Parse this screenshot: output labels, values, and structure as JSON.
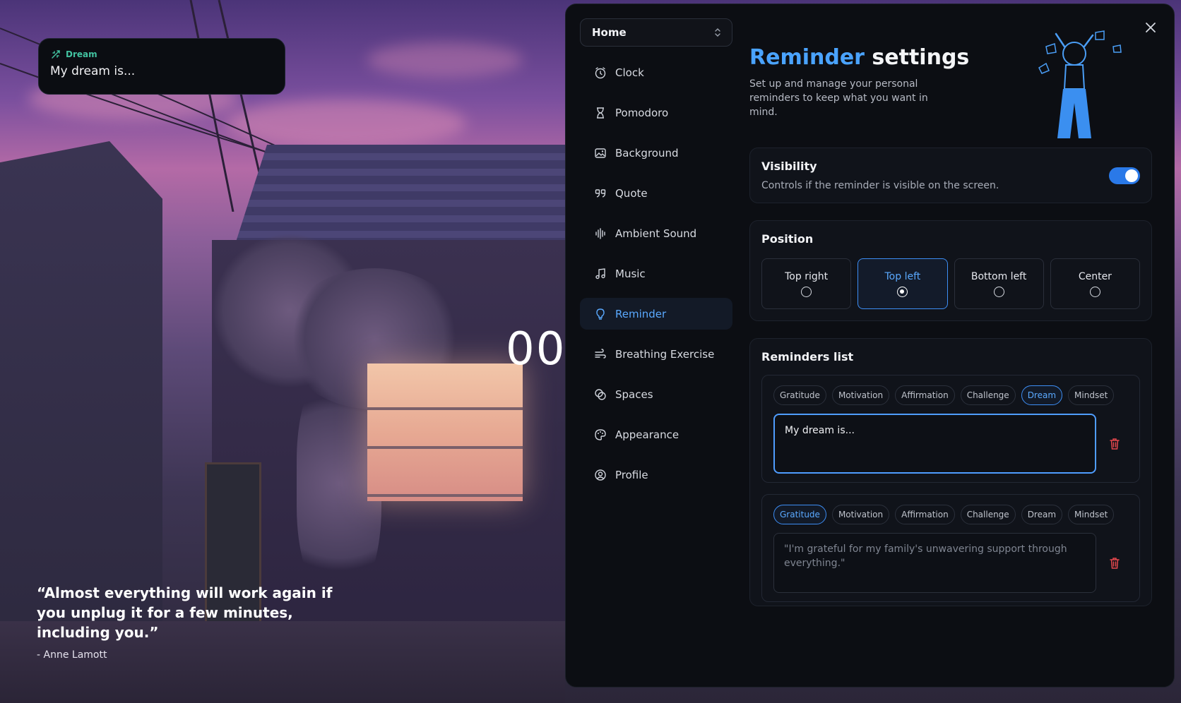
{
  "widget": {
    "tag": "Dream",
    "text": "My dream is..."
  },
  "clock": {
    "digits": "00"
  },
  "quote": {
    "text": "“Almost everything will work again if you unplug it for a few minutes, including you.”",
    "author": "- Anne Lamott"
  },
  "nav": {
    "select_value": "Home",
    "items": [
      {
        "label": "Clock",
        "icon": "clock-icon"
      },
      {
        "label": "Pomodoro",
        "icon": "hourglass-icon"
      },
      {
        "label": "Background",
        "icon": "image-icon"
      },
      {
        "label": "Quote",
        "icon": "quote-icon"
      },
      {
        "label": "Ambient Sound",
        "icon": "sound-wave-icon"
      },
      {
        "label": "Music",
        "icon": "music-icon"
      },
      {
        "label": "Reminder",
        "icon": "lightbulb-icon",
        "active": true
      },
      {
        "label": "Breathing Exercise",
        "icon": "wind-icon"
      },
      {
        "label": "Spaces",
        "icon": "spaces-icon"
      },
      {
        "label": "Appearance",
        "icon": "palette-icon"
      },
      {
        "label": "Profile",
        "icon": "user-circle-icon"
      }
    ]
  },
  "header": {
    "title_accent": "Reminder",
    "title_rest": " settings",
    "subtitle": "Set up and manage your personal reminders to keep what you want in mind."
  },
  "visibility": {
    "title": "Visibility",
    "description": "Controls if the reminder is visible on the screen.",
    "enabled": true
  },
  "position": {
    "title": "Position",
    "options": [
      "Top right",
      "Top left",
      "Bottom left",
      "Center"
    ],
    "selected": "Top left"
  },
  "reminders": {
    "title": "Reminders list",
    "categories": [
      "Gratitude",
      "Motivation",
      "Affirmation",
      "Challenge",
      "Dream",
      "Mindset"
    ],
    "items": [
      {
        "category": "Dream",
        "text": "My dream is..."
      },
      {
        "category": "Gratitude",
        "placeholder": "\"I'm grateful for my family's unwavering support through everything.\""
      }
    ]
  },
  "colors": {
    "accent": "#4aa3ff",
    "widget_tag": "#42c2a0",
    "danger": "#e5484d",
    "toggle": "#2a79e8"
  }
}
